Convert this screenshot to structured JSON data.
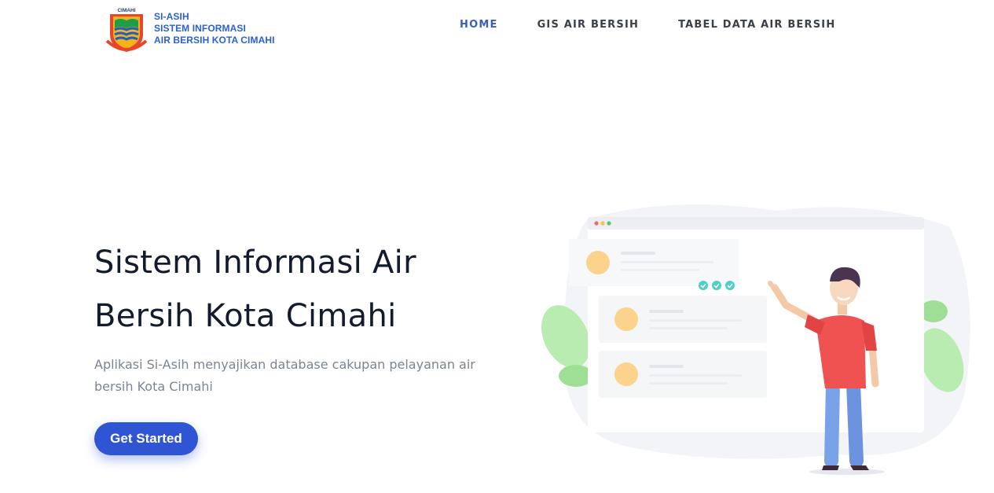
{
  "logo": {
    "emblem_caption": "CIMAHI",
    "line1": "SI-ASIH",
    "line2": "SISTEM INFORMASI",
    "line3": "AIR BERSIH KOTA CIMAHI"
  },
  "nav": {
    "items": [
      {
        "label": "HOME",
        "active": true
      },
      {
        "label": "GIS AIR BERSIH",
        "active": false
      },
      {
        "label": "TABEL DATA AIR BERSIH",
        "active": false
      }
    ]
  },
  "hero": {
    "title": "Sistem Informasi Air Bersih Kota Cimahi",
    "subtitle": "Aplikasi Si-Asih menyajikan database cakupan pelayanan air bersih Kota Cimahi",
    "cta_label": "Get Started"
  },
  "colors": {
    "brand_blue": "#2b5fd9",
    "button_blue": "#2f55d4",
    "nav_active": "#3a5db8",
    "illustration_shirt": "#f05252",
    "illustration_leaf": "#a8e6a0"
  },
  "icons": [
    "city-emblem-icon",
    "window-dots-icon",
    "check-circle-icon",
    "avatar-circle-icon",
    "leaf-icon"
  ]
}
